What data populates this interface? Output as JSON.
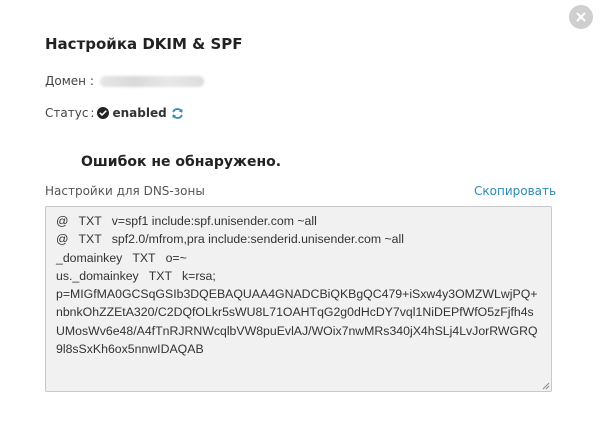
{
  "modal": {
    "title": "Настройка DKIM & SPF",
    "close_icon": "close-icon"
  },
  "domain": {
    "label": "Домен :",
    "value": ""
  },
  "status": {
    "label": "Статус",
    "separator": ":",
    "value": "enabled",
    "status_icon": "check-circle-icon",
    "refresh_icon": "refresh-icon",
    "colors": {
      "check": "#222222",
      "refresh": "#2a8ab8"
    }
  },
  "result": {
    "message": "Ошибок не обнаружено."
  },
  "dns": {
    "label": "Настройки для DNS-зоны",
    "copy_label": "Скопировать",
    "records": "@   TXT   v=spf1 include:spf.unisender.com ~all\n@   TXT   spf2.0/mfrom,pra include:senderid.unisender.com ~all\n_domainkey   TXT   o=~\nus._domainkey   TXT   k=rsa;\np=MIGfMA0GCSqGSIb3DQEBAQUAA4GNADCBiQKBgQC479+iSxw4y3OMZWLwjPQ+nbnkOhZZEtA320/C2DQfOLkr5sWU8L71OAHTqG2g0dHcDY7vql1NiDEPfWfO5zFjfh4sUMosWv6e48/A4fTnRJRNWcqlbVW8puEvlAJ/WOix7nwMRs340jX4hSLj4LvJorRWGRQ9l8sSxKh6ox5nnwIDAQAB"
  },
  "colors": {
    "link": "#2a8ab8",
    "textarea_bg": "#f1f1f1",
    "close_bg": "#cfcfcf"
  }
}
